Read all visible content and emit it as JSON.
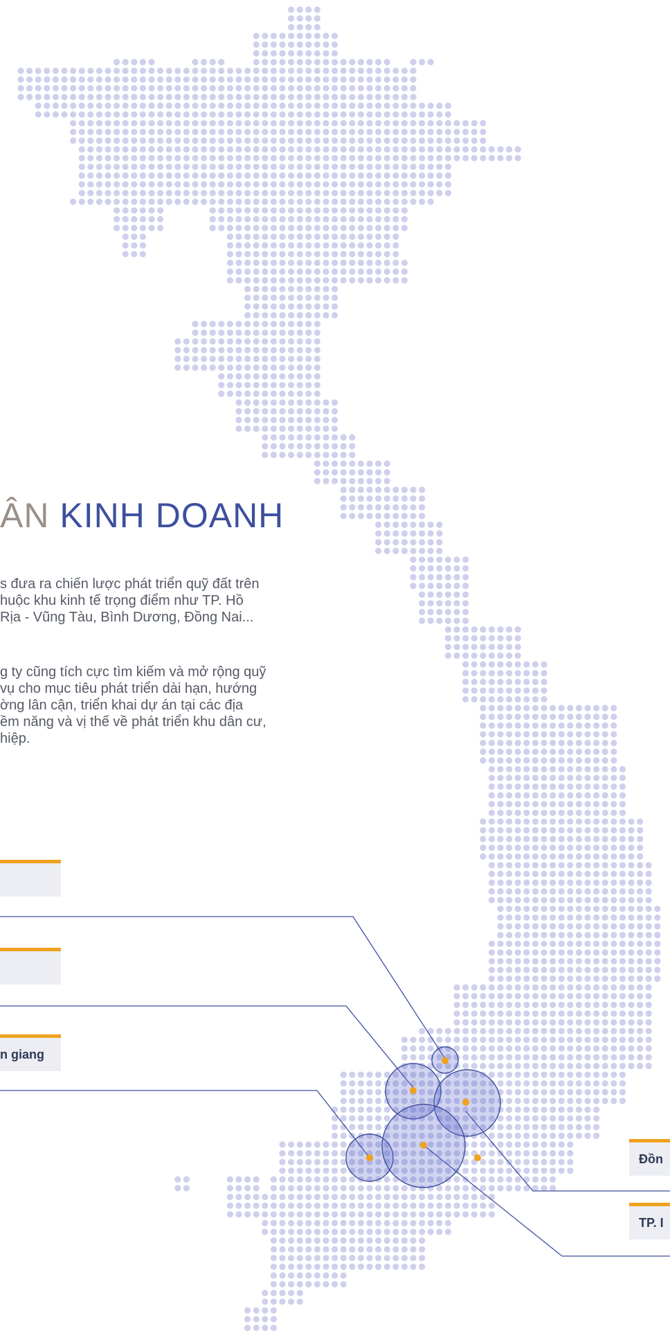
{
  "headline": {
    "part1": "ÂN",
    "part2": "KINH DOANH"
  },
  "paragraphs": [
    {
      "lines": [
        "s đưa ra chiến lược phát triển quỹ đất trên",
        "huộc khu kinh tế trọng điểm như TP. Hồ",
        "Rịa - Vũng Tàu, Bình Dương, Đồng Nai..."
      ]
    },
    {
      "lines": [
        "g ty cũng tích cực tìm kiếm và mở rộng quỹ",
        "vụ cho mục tiêu phát triển dài hạn, hướng",
        "ờng lân cận, triển khai dự án tại các địa",
        "ềm năng và vị thế về phát triển khu dân cư,",
        "hiệp."
      ]
    }
  ],
  "labels": {
    "left_top": "",
    "left_middle": "",
    "left_bottom": "n giang",
    "right_top": "Đồn",
    "right_bottom": "TP. I"
  },
  "colors": {
    "accent_orange": "#f0a11e",
    "map_dot": "#cfd0ec",
    "circle_stroke": "#3d4f9e",
    "headline_gray": "#9b8f8a",
    "headline_blue": "#3d4f9e",
    "label_bg": "#eceef4"
  },
  "icons": {
    "map": "vietnam-dot-map",
    "marker": "orange-location-dot"
  }
}
